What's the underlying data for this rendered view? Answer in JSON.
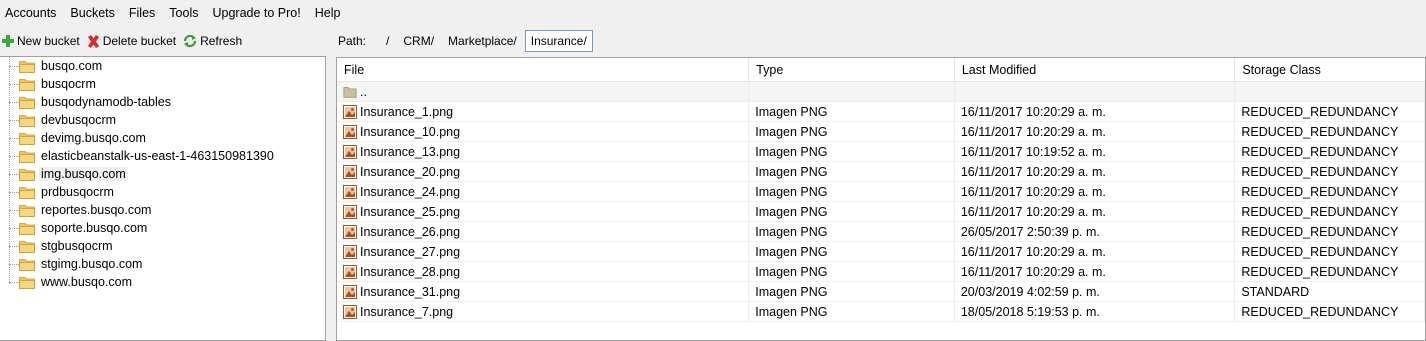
{
  "menu": [
    "Accounts",
    "Buckets",
    "Files",
    "Tools",
    "Upgrade to Pro!",
    "Help"
  ],
  "toolbar": {
    "new_bucket": "New bucket",
    "delete_bucket": "Delete bucket",
    "refresh": "Refresh"
  },
  "path": {
    "label": "Path:",
    "segments": [
      "/",
      "CRM/",
      "Marketplace/",
      "Insurance/"
    ]
  },
  "buckets": [
    "busqo.com",
    "busqocrm",
    "busqodynamodb-tables",
    "devbusqocrm",
    "devimg.busqo.com",
    "elasticbeanstalk-us-east-1-463150981390",
    "img.busqo.com",
    "prdbusqocrm",
    "reportes.busqo.com",
    "soporte.busqo.com",
    "stgbusqocrm",
    "stgimg.busqo.com",
    "www.busqo.com"
  ],
  "selected_bucket": "img.busqo.com",
  "columns": {
    "file": "File",
    "type": "Type",
    "modified": "Last Modified",
    "storage": "Storage Class"
  },
  "parent_row": "..",
  "files": [
    {
      "name": "Insurance_1.png",
      "type": "Imagen PNG",
      "modified": "16/11/2017 10:20:29 a. m.",
      "storage": "REDUCED_REDUNDANCY"
    },
    {
      "name": "Insurance_10.png",
      "type": "Imagen PNG",
      "modified": "16/11/2017 10:20:29 a. m.",
      "storage": "REDUCED_REDUNDANCY"
    },
    {
      "name": "Insurance_13.png",
      "type": "Imagen PNG",
      "modified": "16/11/2017 10:19:52 a. m.",
      "storage": "REDUCED_REDUNDANCY"
    },
    {
      "name": "Insurance_20.png",
      "type": "Imagen PNG",
      "modified": "16/11/2017 10:20:29 a. m.",
      "storage": "REDUCED_REDUNDANCY"
    },
    {
      "name": "Insurance_24.png",
      "type": "Imagen PNG",
      "modified": "16/11/2017 10:20:29 a. m.",
      "storage": "REDUCED_REDUNDANCY"
    },
    {
      "name": "Insurance_25.png",
      "type": "Imagen PNG",
      "modified": "16/11/2017 10:20:29 a. m.",
      "storage": "REDUCED_REDUNDANCY"
    },
    {
      "name": "Insurance_26.png",
      "type": "Imagen PNG",
      "modified": "26/05/2017 2:50:39 p. m.",
      "storage": "REDUCED_REDUNDANCY"
    },
    {
      "name": "Insurance_27.png",
      "type": "Imagen PNG",
      "modified": "16/11/2017 10:20:29 a. m.",
      "storage": "REDUCED_REDUNDANCY"
    },
    {
      "name": "Insurance_28.png",
      "type": "Imagen PNG",
      "modified": "16/11/2017 10:20:29 a. m.",
      "storage": "REDUCED_REDUNDANCY"
    },
    {
      "name": "Insurance_31.png",
      "type": "Imagen PNG",
      "modified": "20/03/2019 4:02:59 p. m.",
      "storage": "STANDARD"
    },
    {
      "name": "Insurance_7.png",
      "type": "Imagen PNG",
      "modified": "18/05/2018 5:19:53 p. m.",
      "storage": "REDUCED_REDUNDANCY"
    }
  ],
  "icons": {
    "new_bucket": "plus-icon",
    "delete_bucket": "red-x-icon",
    "refresh": "refresh-icon",
    "bucket": "folder-icon",
    "file": "png-image-icon",
    "parent": "parent-folder-icon"
  },
  "colors": {
    "plus": "#3aa83a",
    "delete": "#d62b2b",
    "refresh": "#3b9b3b",
    "folder": "#f2c75c",
    "path_active_border": "#6a9ad8"
  }
}
